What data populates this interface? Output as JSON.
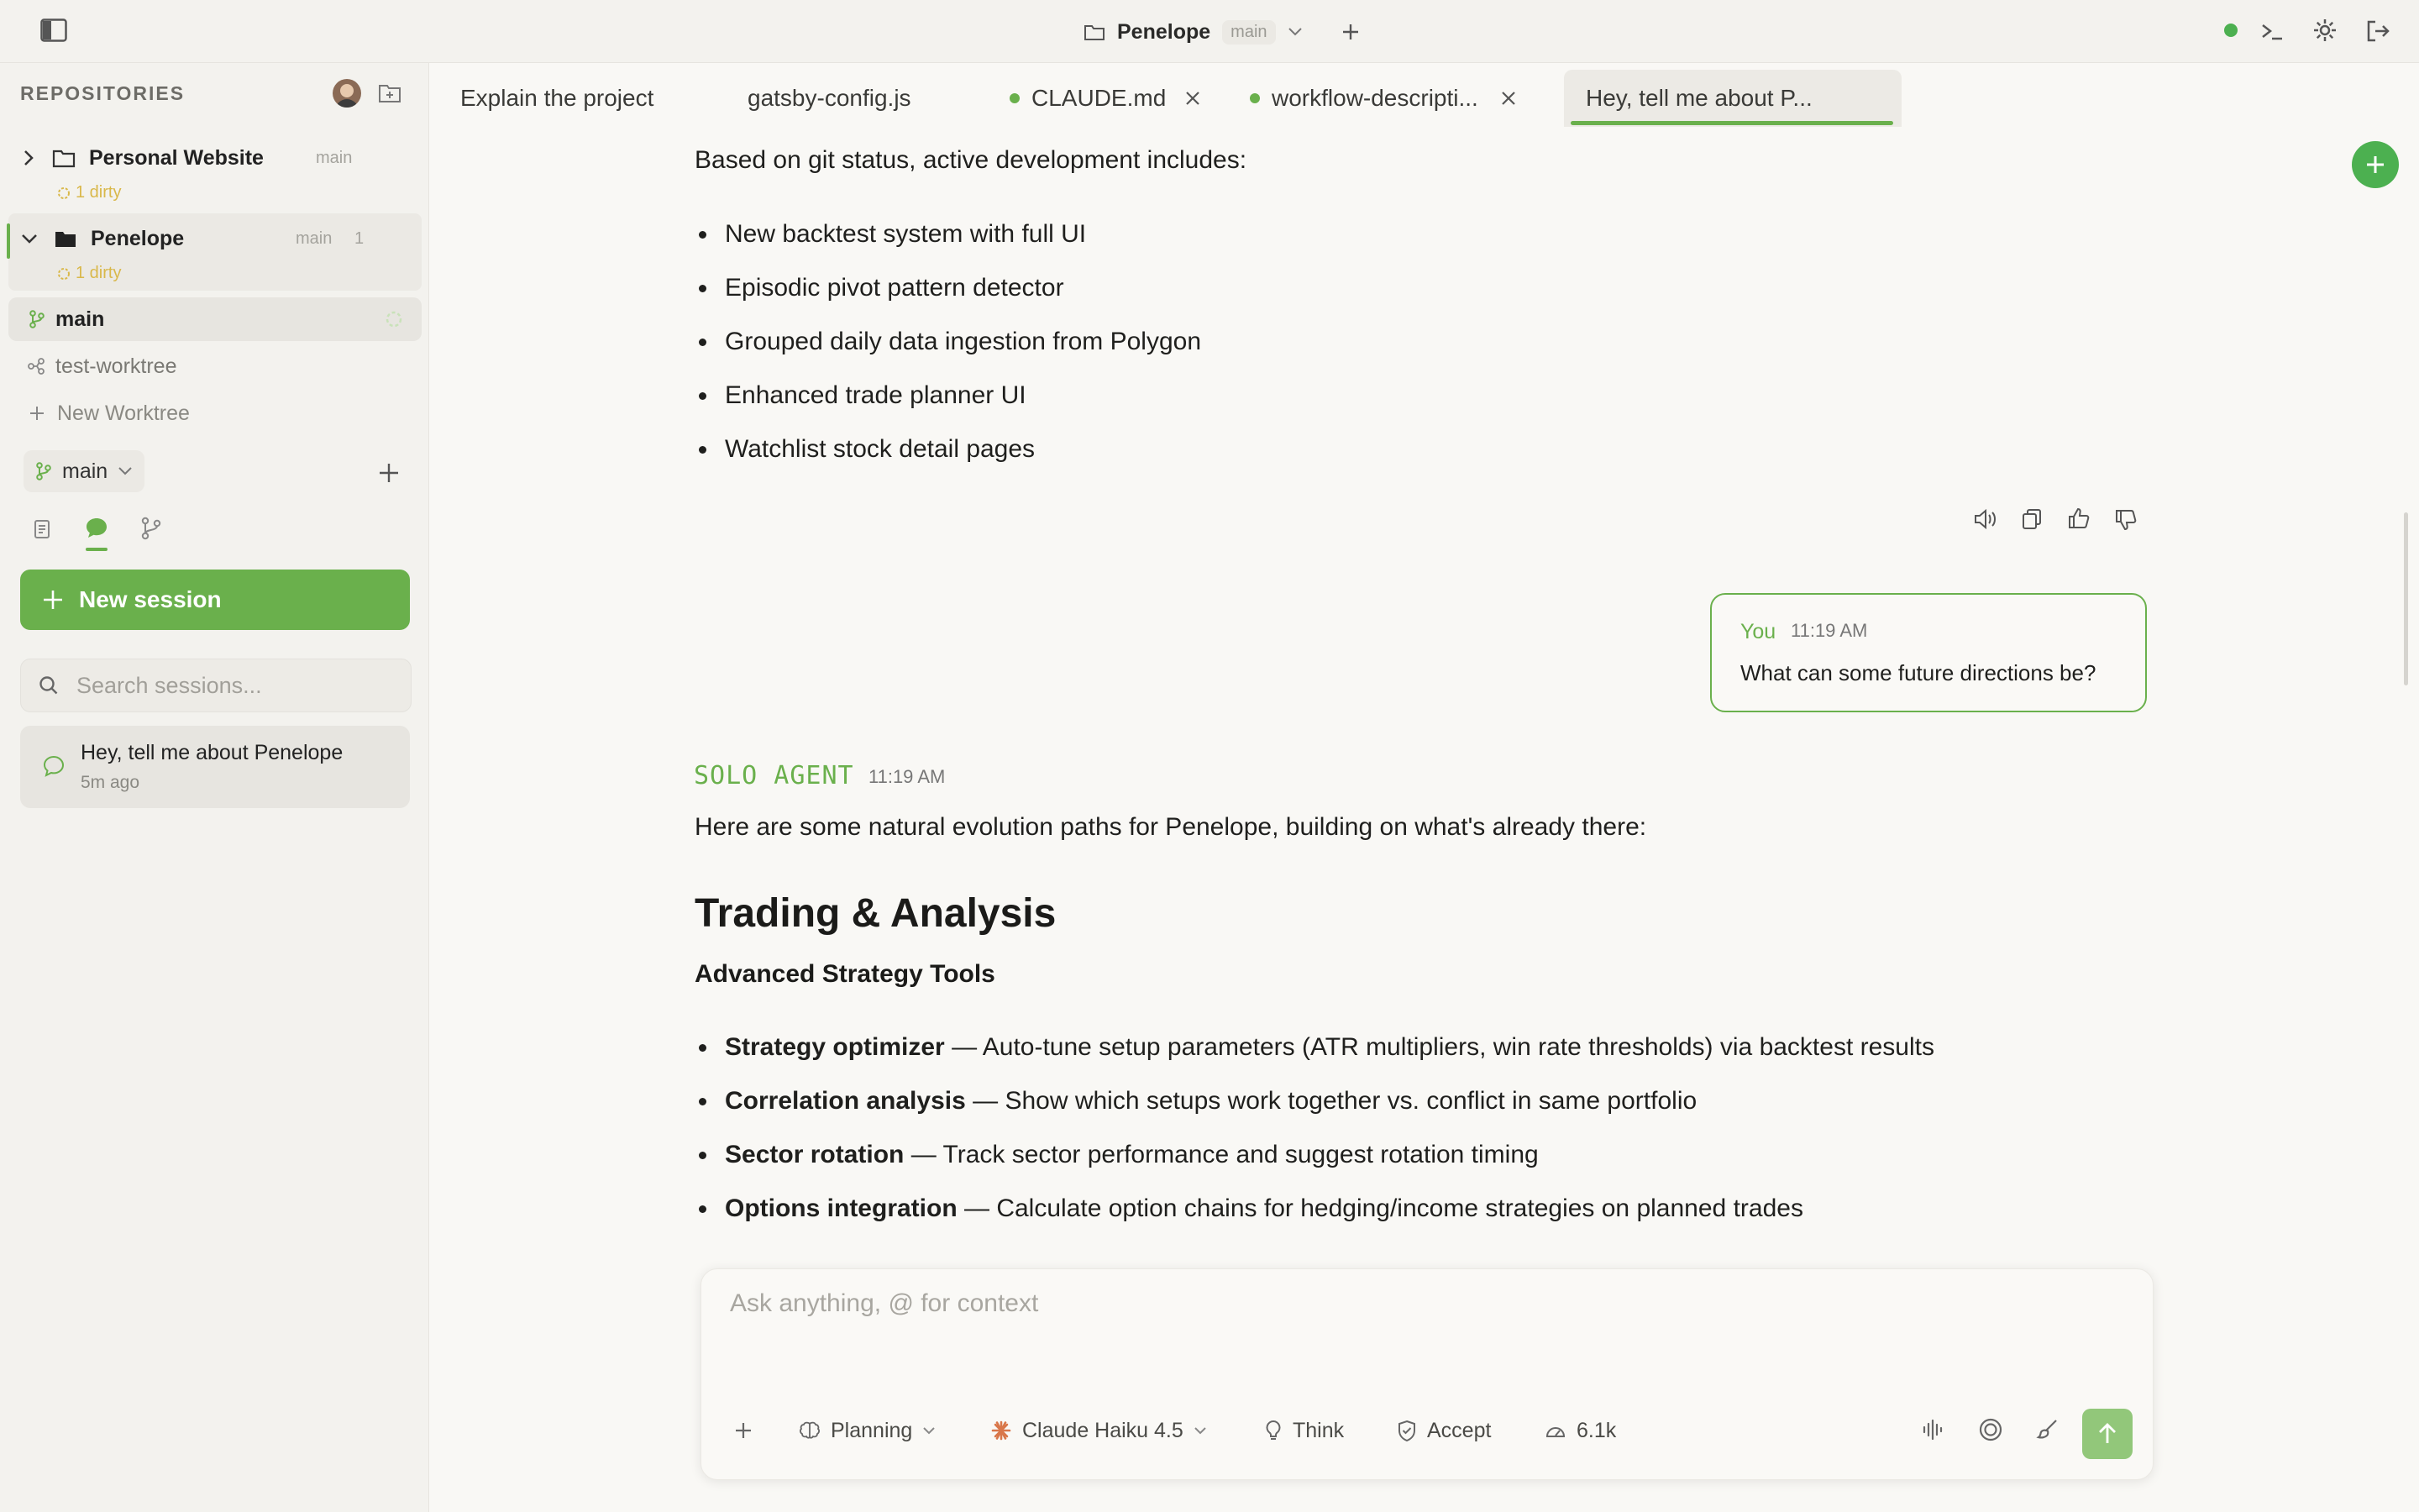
{
  "titlebar": {
    "project": "Penelope",
    "branch": "main"
  },
  "sidebar": {
    "section_title": "REPOSITORIES",
    "repos": [
      {
        "name": "Personal Website",
        "branch": "main",
        "status": "1 dirty"
      },
      {
        "name": "Penelope",
        "branch": "main",
        "count": "1",
        "status": "1 dirty"
      }
    ],
    "worktrees": [
      {
        "label": "main"
      },
      {
        "label": "test-worktree"
      }
    ],
    "new_worktree": "New Worktree",
    "branch_selector": "main",
    "new_session": "New session",
    "search_placeholder": "Search sessions...",
    "sessions": [
      {
        "title": "Hey, tell me about Penelope",
        "time": "5m ago"
      }
    ]
  },
  "tabs": [
    {
      "label": "Explain the project"
    },
    {
      "label": "gatsby-config.js"
    },
    {
      "label": "CLAUDE.md"
    },
    {
      "label": "workflow-descripti..."
    },
    {
      "label": "Hey, tell me about P..."
    }
  ],
  "content": {
    "intro": "Based on git status, active development includes:",
    "dev_items": [
      "New backtest system with full UI",
      "Episodic pivot pattern detector",
      "Grouped daily data ingestion from Polygon",
      "Enhanced trade planner UI",
      "Watchlist stock detail pages"
    ],
    "user_message": {
      "author": "You",
      "time": "11:19 AM",
      "text": "What can some future directions be?"
    },
    "agent": {
      "name": "SOLO AGENT",
      "time": "11:19 AM"
    },
    "agent_intro": "Here are some natural evolution paths for Penelope, building on what's already there:",
    "heading": "Trading & Analysis",
    "subheading": "Advanced Strategy Tools",
    "strategy_items": [
      {
        "title": "Strategy optimizer",
        "text": " — Auto-tune setup parameters (ATR multipliers, win rate thresholds) via backtest results"
      },
      {
        "title": "Correlation analysis",
        "text": " — Show which setups work together vs. conflict in same portfolio"
      },
      {
        "title": "Sector rotation",
        "text": " — Track sector performance and suggest rotation timing"
      },
      {
        "title": "Options integration",
        "text": " — Calculate option chains for hedging/income strategies on planned trades"
      }
    ]
  },
  "composer": {
    "placeholder": "Ask anything, @ for context",
    "mode": "Planning",
    "model": "Claude Haiku 4.5",
    "think": "Think",
    "accept": "Accept",
    "tokens": "6.1k"
  },
  "colors": {
    "accent": "#6ab04c",
    "dirty": "#d9b84a",
    "background": "#f9f8f5",
    "sidebar": "#f3f2ee"
  }
}
